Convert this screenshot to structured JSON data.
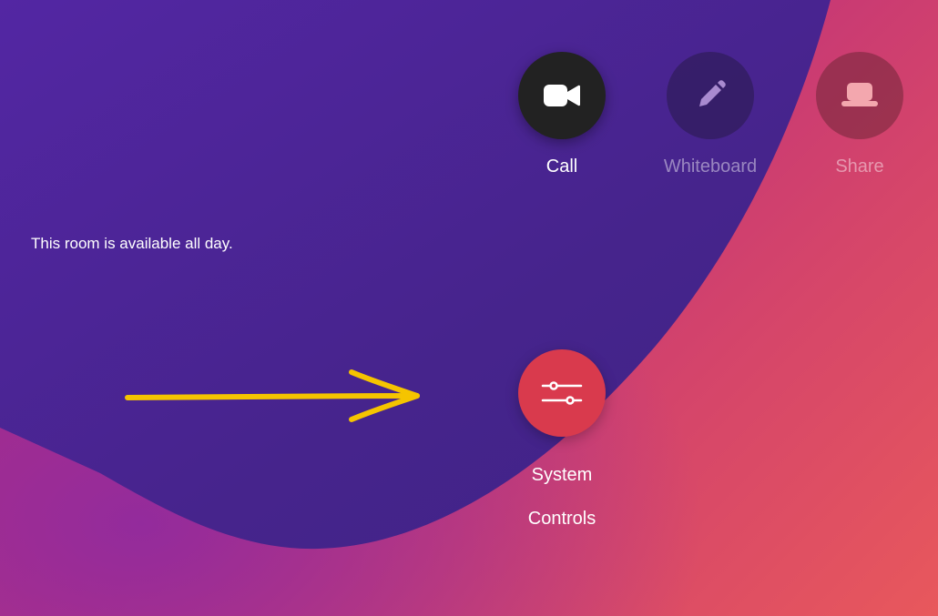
{
  "status": {
    "message": "This room is available all day."
  },
  "actions": {
    "call": {
      "label": "Call",
      "icon": "video-camera-icon"
    },
    "whiteboard": {
      "label": "Whiteboard",
      "icon": "pencil-icon"
    },
    "share": {
      "label": "Share",
      "icon": "share-screen-icon"
    }
  },
  "system_controls": {
    "label_line1": "System",
    "label_line2": "Controls",
    "icon": "sliders-icon"
  },
  "annotation": {
    "icon": "arrow-annotation",
    "color": "#f5c400"
  },
  "colors": {
    "background_dark": "#4a2590",
    "background_warm": "#e8585c",
    "call_button": "#222222",
    "system_button": "#d93a4d"
  }
}
